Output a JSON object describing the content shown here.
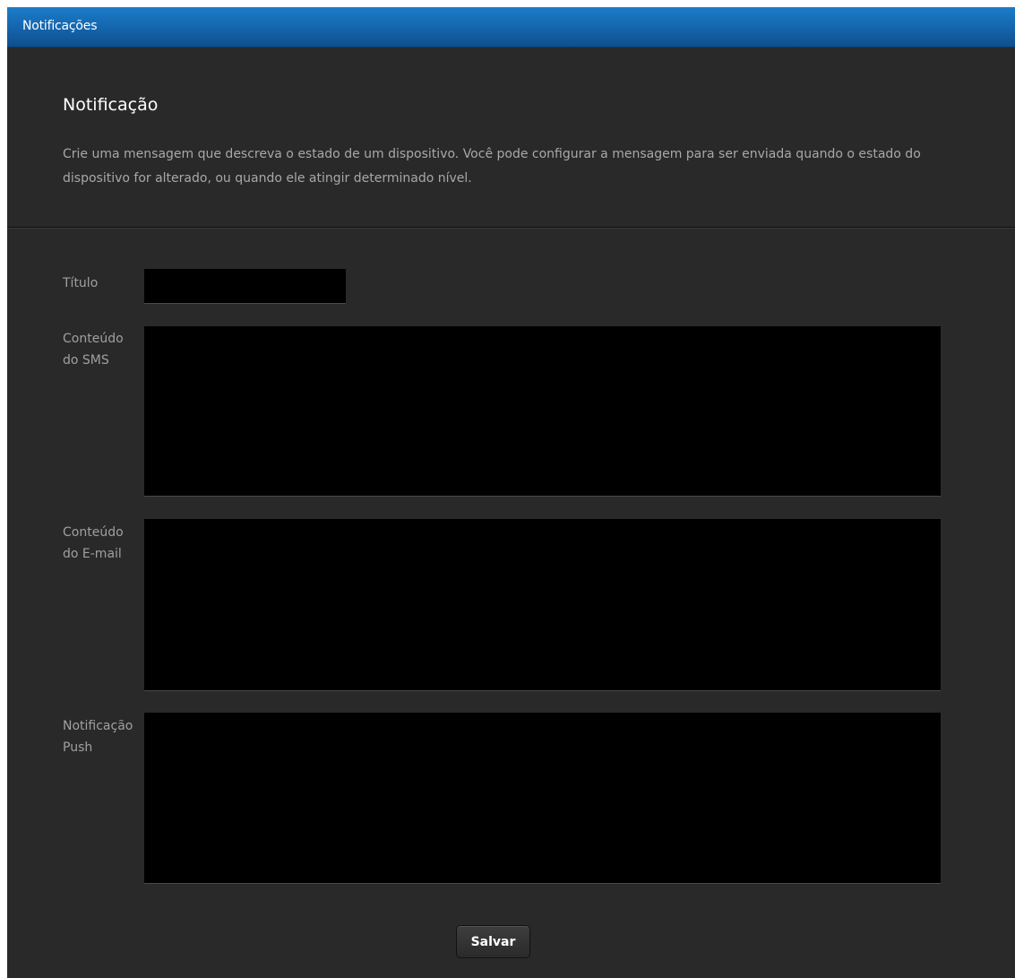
{
  "window": {
    "title": "Notificações"
  },
  "header": {
    "heading": "Notificação",
    "description": "Crie uma mensagem que descreva o estado de um dispositivo. Você pode configurar a mensagem para ser enviada quando o estado do dispositivo for alterado, ou quando ele atingir determinado nível."
  },
  "form": {
    "title_label": "Título",
    "title_value": "",
    "sms_label_line1": "Conteúdo",
    "sms_label_line2": "do SMS",
    "sms_value": "",
    "email_label_line1": "Conteúdo",
    "email_label_line2": "do E-mail",
    "email_value": "",
    "push_label_line1": "Notificação",
    "push_label_line2": "Push",
    "push_value": "",
    "save_label": "Salvar"
  },
  "colors": {
    "titlebar": "#1464ab",
    "background": "#292929",
    "input_background": "#000000"
  }
}
